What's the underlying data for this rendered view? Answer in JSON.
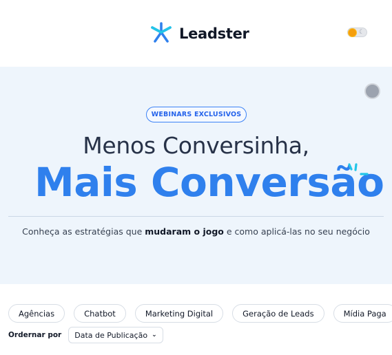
{
  "header": {
    "logo_text": "Leadster"
  },
  "theme_toggle": {
    "state": "light",
    "moon_glyph": "☾"
  },
  "hero": {
    "badge": "WEBINARS EXCLUSIVOS",
    "headline_line1": "Menos Conversinha,",
    "headline_line2": "Mais Conversão",
    "subtitle_pre": "Conheça as estratégias que ",
    "subtitle_bold": "mudaram o jogo",
    "subtitle_post": " e como aplicá-las no seu negócio"
  },
  "filters": {
    "chips": [
      {
        "label": "Agências"
      },
      {
        "label": "Chatbot"
      },
      {
        "label": "Marketing Digital"
      },
      {
        "label": "Geração de Leads"
      },
      {
        "label": "Mídia Paga"
      }
    ]
  },
  "sort": {
    "label": "Ordernar por",
    "selected": "Data de Publicação"
  },
  "colors": {
    "brand_blue": "#2f80ed",
    "hero_bg": "#eef5fc",
    "accent_cyan": "#22c5e8"
  }
}
